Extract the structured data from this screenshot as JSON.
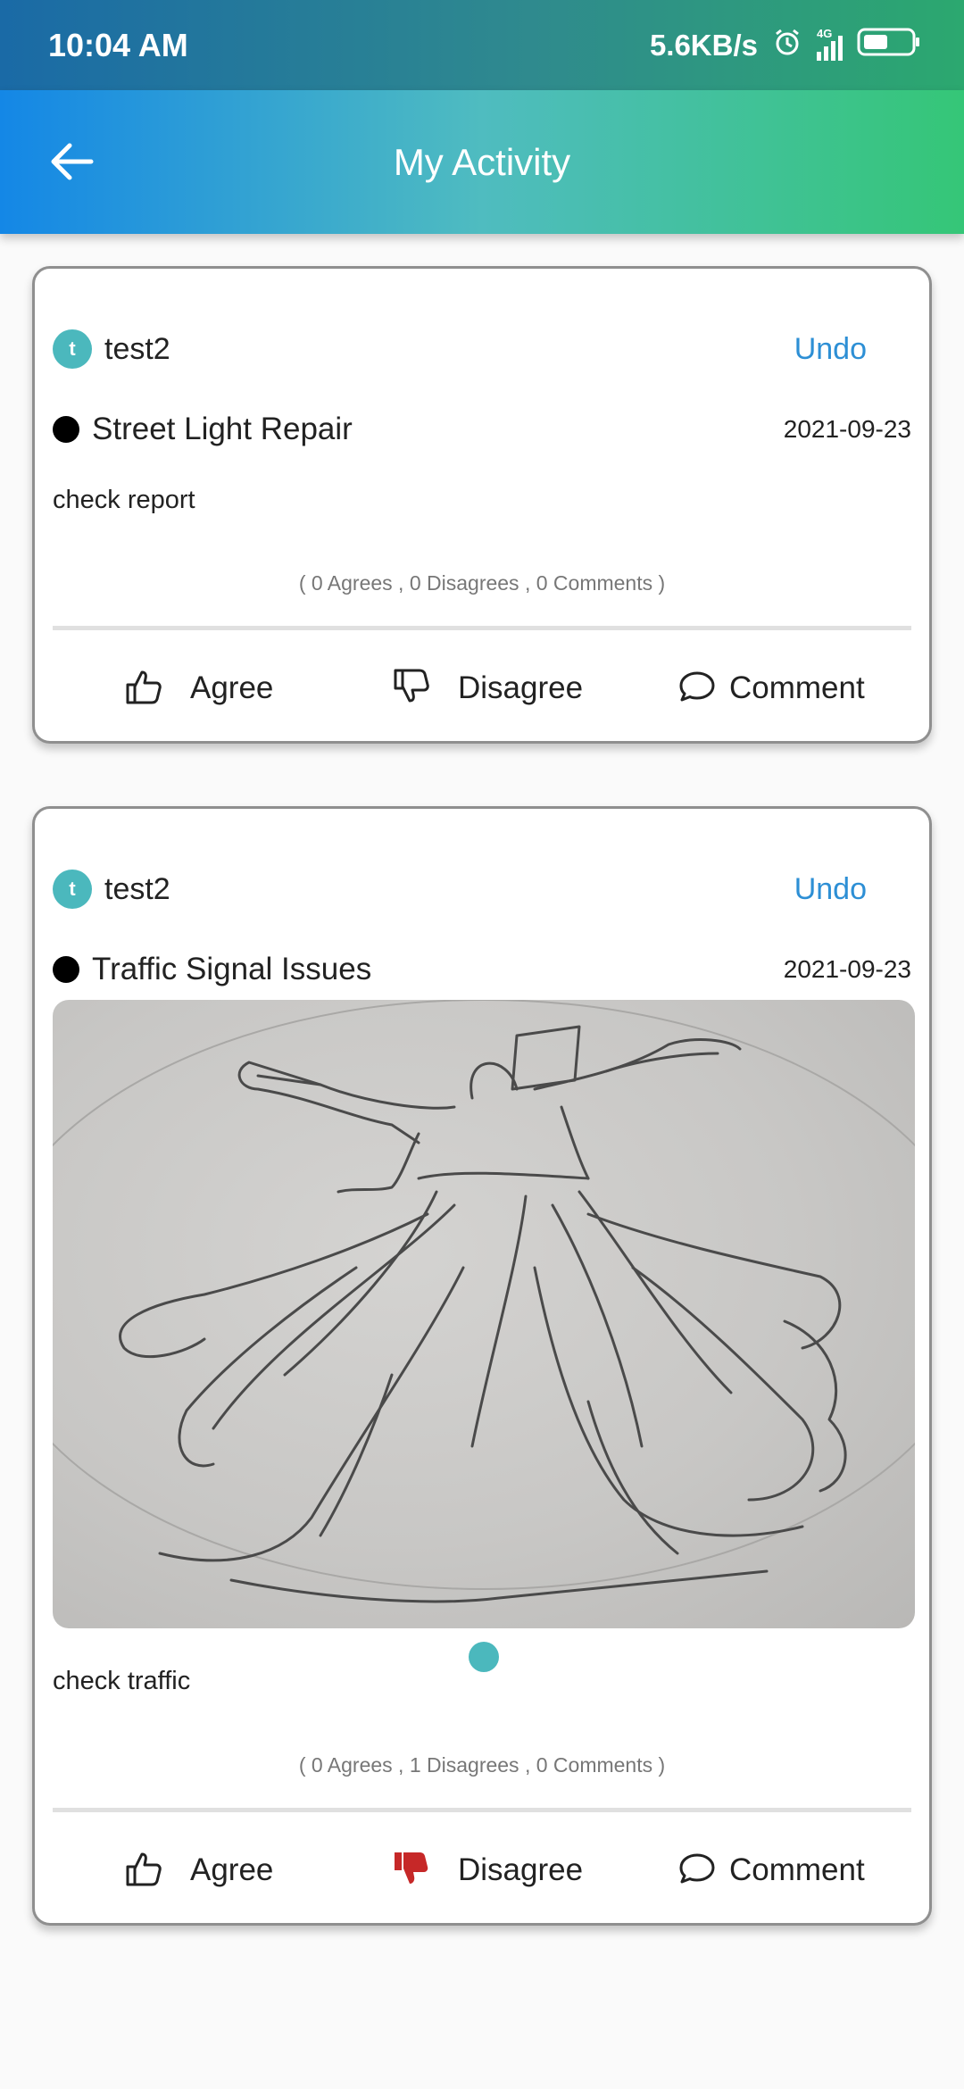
{
  "status_bar": {
    "time": "10:04 AM",
    "network_speed": "5.6KB/s",
    "network_type": "4G",
    "icons": [
      "alarm-icon",
      "signal-icon",
      "battery-icon"
    ]
  },
  "app_bar": {
    "title": "My Activity",
    "back_icon": "arrow-left-icon"
  },
  "posts": [
    {
      "avatar_letter": "t",
      "username": "test2",
      "undo_label": "Undo",
      "category": "Street Light Repair",
      "date": "2021-09-23",
      "description": "check report",
      "stats": "( 0 Agrees , 0 Disagrees , 0 Comments )",
      "has_image": false,
      "disagree_active": false,
      "actions": {
        "agree": "Agree",
        "disagree": "Disagree",
        "comment": "Comment"
      }
    },
    {
      "avatar_letter": "t",
      "username": "test2",
      "undo_label": "Undo",
      "category": "Traffic Signal Issues",
      "date": "2021-09-23",
      "image": "pencil-sketch-whirling-dancer",
      "description": "check traffic",
      "stats": "( 0 Agrees , 1 Disagrees , 0 Comments )",
      "has_image": true,
      "disagree_active": true,
      "actions": {
        "agree": "Agree",
        "disagree": "Disagree",
        "comment": "Comment"
      }
    }
  ],
  "colors": {
    "accent": "#2d8fd5",
    "avatar": "#4bb8bd",
    "disagree_active": "#c62828"
  }
}
